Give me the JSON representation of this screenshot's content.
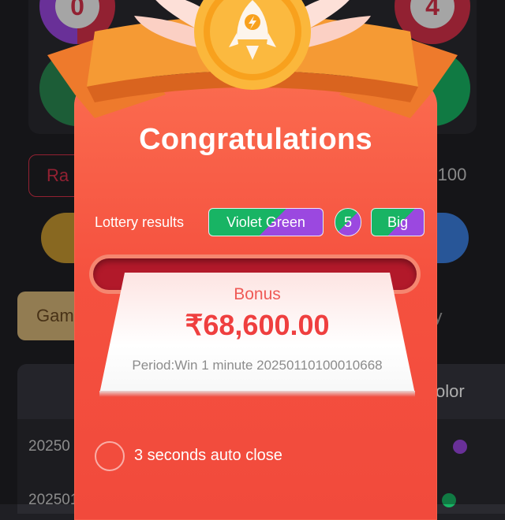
{
  "background": {
    "balls": [
      {
        "number": "0"
      },
      {
        "number": "4"
      }
    ],
    "random_button": "Ra",
    "multiplier": "X100",
    "tab_game": "Gam",
    "tab_history": "ory",
    "table_header_color": "olor",
    "rows": [
      {
        "period": "20250"
      },
      {
        "period": "202501"
      }
    ]
  },
  "modal": {
    "title": "Congratulations",
    "lottery_label": "Lottery results",
    "result_color": "Violet Green",
    "result_number": "5",
    "result_size": "Big",
    "bonus_label": "Bonus",
    "bonus_amount": "₹68,600.00",
    "period_text": "Period:Win 1 minute 20250110100010668",
    "auto_close_text": "3 seconds auto close"
  },
  "colors": {
    "modal_red": "#f5513f",
    "green": "#18b464",
    "violet": "#9b48e0",
    "amount_red": "#ef3f3f",
    "badge_gold": "#f5a51a"
  },
  "icons": {
    "badge": "rocket-icon",
    "lightning": "lightning-icon"
  }
}
